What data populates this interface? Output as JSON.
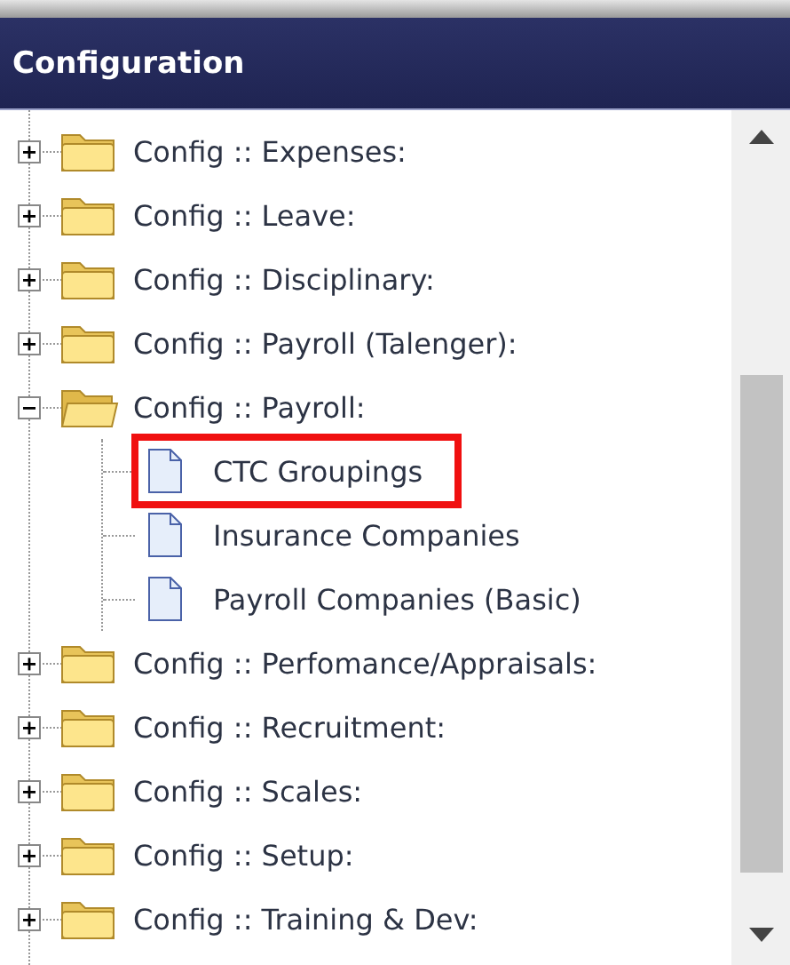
{
  "panel": {
    "title": "Configuration"
  },
  "tree": [
    {
      "label": "Config :: Expenses:",
      "expanded": false
    },
    {
      "label": "Config :: Leave:",
      "expanded": false
    },
    {
      "label": "Config :: Disciplinary:",
      "expanded": false
    },
    {
      "label": "Config :: Payroll (Talenger):",
      "expanded": false
    },
    {
      "label": "Config :: Payroll:",
      "expanded": true,
      "children": [
        {
          "label": "CTC Groupings",
          "highlighted": true
        },
        {
          "label": "Insurance Companies",
          "highlighted": false
        },
        {
          "label": "Payroll Companies (Basic)",
          "highlighted": false
        }
      ]
    },
    {
      "label": "Config :: Perfomance/Appraisals:",
      "expanded": false
    },
    {
      "label": "Config :: Recruitment:",
      "expanded": false
    },
    {
      "label": "Config :: Scales:",
      "expanded": false
    },
    {
      "label": "Config :: Setup:",
      "expanded": false
    },
    {
      "label": "Config :: Training & Dev:",
      "expanded": false
    }
  ]
}
